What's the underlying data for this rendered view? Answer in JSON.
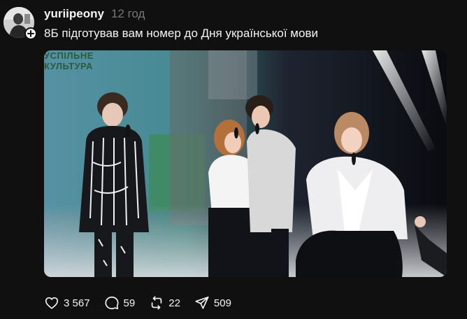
{
  "post": {
    "username": "yuriipeony",
    "time": "12 год",
    "text": "8Б підготував вам номер до Дня української мови",
    "media": {
      "watermark_line1": "УСПІЛЬНЕ",
      "watermark_line2": "КУЛЬТУРА"
    },
    "actions": {
      "likes": "3 567",
      "comments": "59",
      "reposts": "22",
      "shares": "509"
    }
  },
  "icons": {
    "like": "heart-icon",
    "comment": "comment-bubble-icon",
    "repost": "repost-arrows-icon",
    "share": "send-paper-plane-icon",
    "follow": "plus-icon"
  },
  "colors": {
    "background": "#101010",
    "text_primary": "#f3f5f7",
    "text_secondary": "#777777"
  }
}
